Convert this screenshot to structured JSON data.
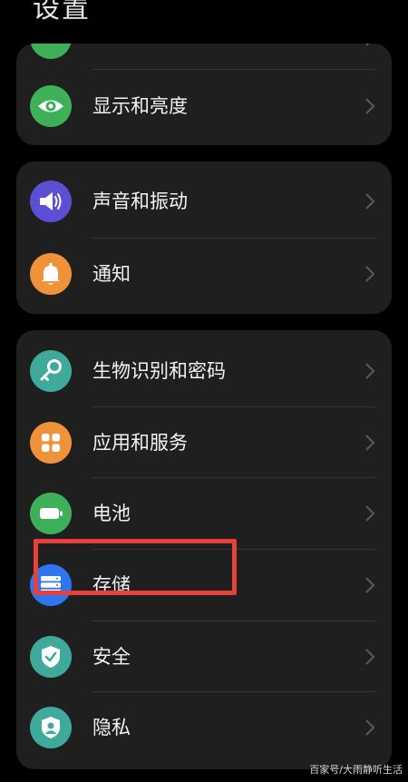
{
  "header": {
    "title": "设置"
  },
  "colors": {
    "background": "#000000",
    "card": "#1f1f1f",
    "green": "#3fb05a",
    "purple": "#5b4fd6",
    "orange": "#f0923a",
    "teal": "#3fa99c",
    "blue": "#2f74f0",
    "highlight_red": "#e8413a"
  },
  "groups": [
    {
      "items": [
        {
          "label": "",
          "icon": "partially-hidden-icon"
        },
        {
          "label": "显示和亮度",
          "icon": "eye-icon"
        }
      ]
    },
    {
      "items": [
        {
          "label": "声音和振动",
          "icon": "speaker-icon"
        },
        {
          "label": "通知",
          "icon": "bell-icon"
        }
      ]
    },
    {
      "items": [
        {
          "label": "生物识别和密码",
          "icon": "key-icon"
        },
        {
          "label": "应用和服务",
          "icon": "apps-grid-icon"
        },
        {
          "label": "电池",
          "icon": "battery-icon"
        },
        {
          "label": "存储",
          "icon": "storage-icon"
        },
        {
          "label": "安全",
          "icon": "shield-check-icon"
        },
        {
          "label": "隐私",
          "icon": "privacy-person-icon"
        }
      ]
    }
  ],
  "watermark": "百家号/大雨静听生活"
}
